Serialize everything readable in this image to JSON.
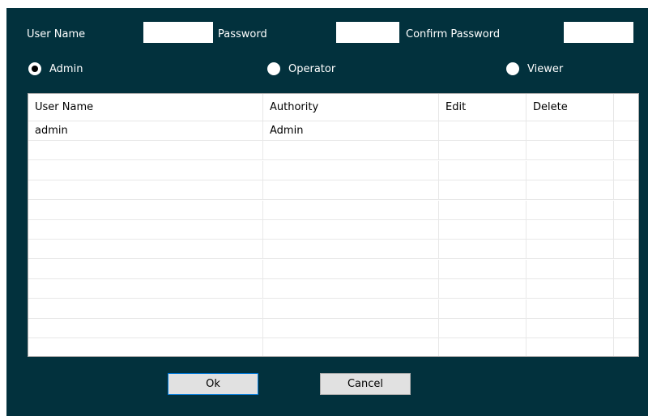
{
  "form": {
    "username_label": "User Name",
    "username_value": "",
    "password_label": "Password",
    "password_value": "",
    "confirm_label": "Confirm Password",
    "confirm_value": ""
  },
  "roles": {
    "selected": "Admin",
    "options": [
      "Admin",
      "Operator",
      "Viewer"
    ]
  },
  "table": {
    "columns": [
      "User Name",
      "Authority",
      "Edit",
      "Delete"
    ],
    "rows": [
      [
        "admin",
        "Admin",
        "",
        ""
      ]
    ]
  },
  "buttons": {
    "ok_label": "Ok",
    "cancel_label": "Cancel"
  },
  "colors": {
    "dialog_background": "#02313d",
    "text": "#ffffff"
  }
}
